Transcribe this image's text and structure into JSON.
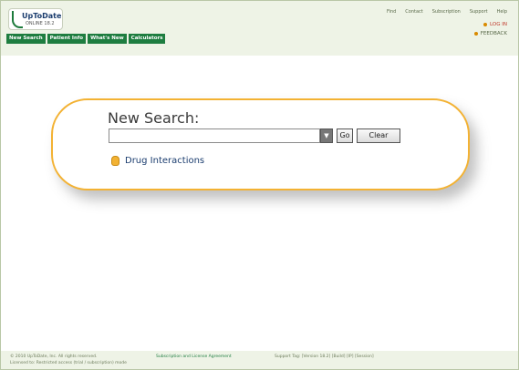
{
  "header": {
    "logo_name": "UpToDate",
    "logo_sub": "ONLINE 18.2",
    "nav": [
      "New Search",
      "Patient Info",
      "What's New",
      "Calculators"
    ],
    "top_links": [
      "Find",
      "Contact",
      "Subscription",
      "Support",
      "Help"
    ],
    "login": "LOG IN",
    "feedback": "FEEDBACK",
    "accent_color": "#1e7d40"
  },
  "search": {
    "title": "New Search:",
    "input_value": "",
    "go_label": "Go",
    "clear_label": "Clear",
    "drug_link": "Drug Interactions",
    "border_color": "#f3b233"
  },
  "footer": {
    "line1": "© 2010 UpToDate, Inc. All rights reserved.",
    "line2": "Licensed to: Restricted access (trial / subscription) mode",
    "mid": "Subscription and License Agreement",
    "right": "Support Tag: [Version 18.2] [Build] [IP] [Session]"
  }
}
